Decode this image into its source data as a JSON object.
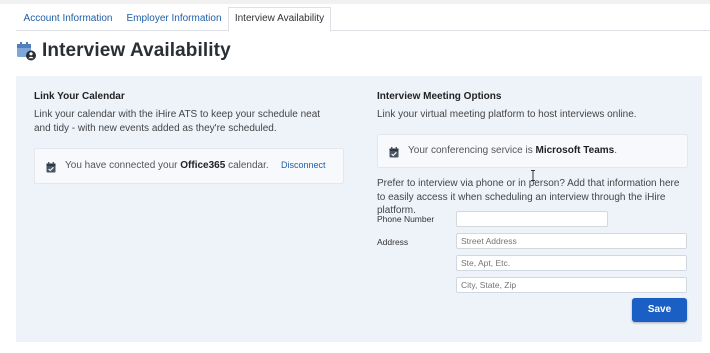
{
  "tabs": [
    "Account Information",
    "Employer Information",
    "Interview Availability"
  ],
  "page_title": "Interview Availability",
  "calendar": {
    "heading": "Link Your Calendar",
    "description": "Link your calendar with the iHire ATS to keep your schedule neat and tidy - with new events added as they're scheduled.",
    "status_prefix": "You have connected your ",
    "status_bold": "Office365",
    "status_suffix": " calendar.",
    "disconnect": "Disconnect"
  },
  "meeting": {
    "heading": "Interview Meeting Options",
    "description": "Link your virtual meeting platform to host interviews online.",
    "service_prefix": "Your conferencing service is ",
    "service_bold": "Microsoft Teams",
    "service_suffix": ".",
    "contact_text": "Prefer to interview via phone or in person? Add that information here to easily access it when scheduling an interview through the iHire platform.",
    "phone_label": "Phone Number",
    "phone_value": "",
    "address_label": "Address",
    "street_placeholder": "Street Address",
    "suite_placeholder": "Ste, Apt, Etc.",
    "city_placeholder": "City, State, Zip",
    "save": "Save"
  },
  "colors": {
    "accent": "#1a5fc4",
    "link": "#1d5fa8",
    "panel": "#eef3fa"
  },
  "icons": [
    "calendar-user-icon",
    "calendar-icon"
  ]
}
